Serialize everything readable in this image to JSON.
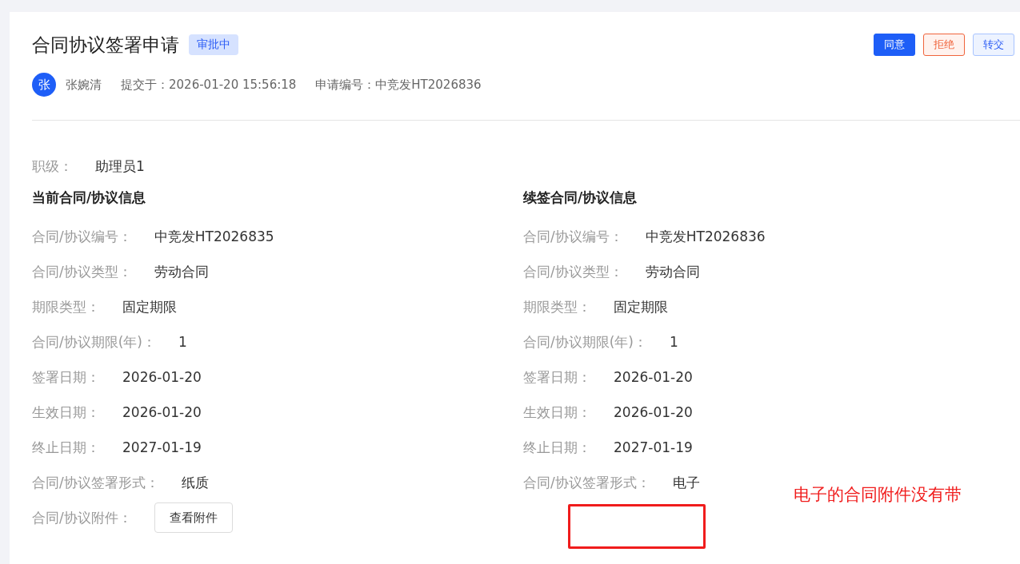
{
  "header": {
    "title": "合同协议签署申请",
    "status": "审批中",
    "actions": [
      {
        "label": "同意",
        "kind": "primary"
      },
      {
        "label": "拒绝",
        "kind": "danger"
      },
      {
        "label": "转交",
        "kind": "secondary"
      }
    ]
  },
  "applicant": {
    "avatar": "张",
    "name": "张婉清",
    "submitted": "提交于：2026-01-20 15:56:18",
    "number": "申请编号：中竞发HT2026836"
  },
  "grade": {
    "label": "职级：",
    "value": "助理员1"
  },
  "sections": [
    {
      "title": "当前合同/协议信息",
      "fields": [
        {
          "label": "合同/协议编号：",
          "value": "中竞发HT2026835"
        },
        {
          "label": "合同/协议类型：",
          "value": "劳动合同"
        },
        {
          "label": "期限类型：",
          "value": "固定期限"
        },
        {
          "label": "合同/协议期限(年)：",
          "value": "1"
        },
        {
          "label": "签署日期：",
          "value": "2026-01-20"
        },
        {
          "label": "生效日期：",
          "value": "2026-01-20"
        },
        {
          "label": "终止日期：",
          "value": "2027-01-19"
        },
        {
          "label": "合同/协议签署形式：",
          "value": "纸质"
        },
        {
          "label": "合同/协议附件：",
          "button": "查看附件"
        }
      ]
    },
    {
      "title": "续签合同/协议信息",
      "fields": [
        {
          "label": "合同/协议编号：",
          "value": "中竞发HT2026836"
        },
        {
          "label": "合同/协议类型：",
          "value": "劳动合同"
        },
        {
          "label": "期限类型：",
          "value": "固定期限"
        },
        {
          "label": "合同/协议期限(年)：",
          "value": "1"
        },
        {
          "label": "签署日期：",
          "value": "2026-01-20"
        },
        {
          "label": "生效日期：",
          "value": "2026-01-20"
        },
        {
          "label": "终止日期：",
          "value": "2027-01-19"
        },
        {
          "label": "合同/协议签署形式：",
          "value": "电子"
        }
      ]
    }
  ],
  "annotation": {
    "note": "电子的合同附件没有带"
  }
}
